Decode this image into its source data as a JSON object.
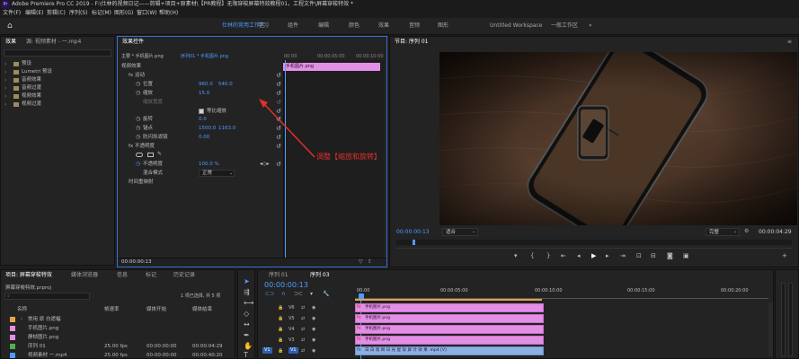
{
  "titlebar": {
    "logo": "Pr",
    "title": "Adobe Premiere Pro CC 2019 - F:\\仕林的视频日记——剪辑+项目+原素材\\【PR教程】无限穿梭屏幕特效教程01，工程文件\\屏幕穿梭特效 *"
  },
  "menu": [
    "文件(F)",
    "编辑(E)",
    "剪辑(C)",
    "序列(S)",
    "标记(M)",
    "图形(G)",
    "窗口(W)",
    "帮助(H)"
  ],
  "workspaces": [
    "仕林的常用工作区",
    "学习",
    "组件",
    "编辑",
    "颜色",
    "效果",
    "音频",
    "图形",
    "Untitled Workspace",
    "一般工作区"
  ],
  "effects_panel": {
    "tabs": [
      "效果",
      "源: 视频素材 - 一.mp4"
    ],
    "items": [
      "预设",
      "Lumetri 预设",
      "音频效果",
      "音频过渡",
      "视频效果",
      "视频过渡"
    ]
  },
  "effect_controls": {
    "tab": "效果控件",
    "header_src": "主要 * 手机图片.png",
    "header_seq": "序列01 * 手机图片.png",
    "clip_name": "手机图片.png",
    "times": [
      "00:00",
      "00:00:05:00",
      "00:00:10:00"
    ],
    "section_video": "视频效果",
    "motion": "fx  运动",
    "position": "位置",
    "position_x": "960.0",
    "position_y": "540.0",
    "scale": "缩放",
    "scale_val": "15.0",
    "scale_width": "缩放宽度",
    "uniform": "等比缩放",
    "rotation": "旋转",
    "rotation_val": "0.0",
    "anchor": "锚点",
    "anchor_x": "1500.0",
    "anchor_y": "1163.0",
    "antiflicker": "防闪烁滤镜",
    "antiflicker_val": "0.00",
    "opacity_section": "fx  不透明度",
    "opacity": "不透明度",
    "opacity_val": "100.0 %",
    "blend": "混合模式",
    "blend_val": "正常",
    "time_remap": "时间重映射",
    "timecode": "00:00:00:13"
  },
  "annotation": {
    "text": "调整【缩放和旋转】",
    "color": "#e0302a"
  },
  "program": {
    "tab": "节目: 序列 01",
    "timecode": "00:00:00:13",
    "fit": "适合",
    "quality": "完整",
    "duration": "00:00:04:29"
  },
  "project": {
    "tabs": [
      "项目: 屏幕穿梭特效",
      "媒体浏览器",
      "信息",
      "标记",
      "历史记录"
    ],
    "file": "屏幕穿梭特效.prproj",
    "selected_count": "1 项已选择, 共 5 项",
    "columns": [
      "名称",
      "帧速率",
      "媒体开始",
      "媒体结束"
    ],
    "rows": [
      {
        "color": "#e5a54a",
        "name": "常用 原 白遮幅",
        "fps": "",
        "start": "",
        "end": ""
      },
      {
        "color": "#e38fe6",
        "name": "手机图片.png",
        "fps": "",
        "start": "",
        "end": ""
      },
      {
        "color": "#e38fe6",
        "name": "静帧图片.png",
        "fps": "",
        "start": "",
        "end": ""
      },
      {
        "color": "#4caf50",
        "name": "序列 01",
        "fps": "25.00 fps",
        "start": "00:00:00:00",
        "end": "00:00:04:29"
      },
      {
        "color": "#4f9cff",
        "name": "视频素材 一.mp4",
        "fps": "25.00 fps",
        "start": "00:00:00:00",
        "end": "00:00:40:20"
      }
    ]
  },
  "timeline": {
    "tabs": [
      "序列 01",
      "序列 03"
    ],
    "timecode": "00:00:00:13",
    "ruler": [
      "00:00",
      "00:00:05:00",
      "00:00:10:00",
      "00:00:15:00",
      "00:00:20:00"
    ],
    "tracks": [
      "V6",
      "V5",
      "V4",
      "V3",
      "V2",
      "V1"
    ],
    "clips": [
      "手机图片.png",
      "手机图片.png",
      "手机图片.png",
      "手机图片.png",
      "日 白 现 目 日 光 屋 穿 屏 计 效 果 .mp4 [V]"
    ]
  }
}
